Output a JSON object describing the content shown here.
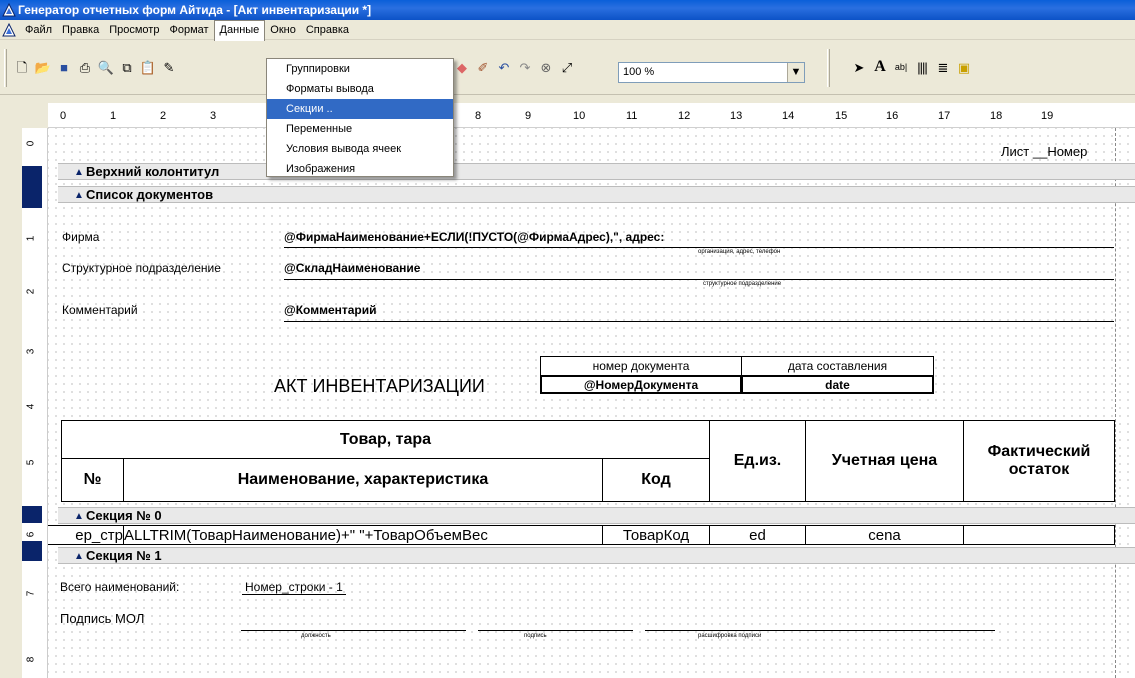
{
  "window": {
    "title": "Генератор отчетных форм Айтида - [Акт инвентаризации *]"
  },
  "menubar": {
    "items": [
      "Файл",
      "Правка",
      "Просмотр",
      "Формат",
      "Данные",
      "Окно",
      "Справка"
    ],
    "active": "Данные"
  },
  "toolbar": {
    "zoom": "100 %"
  },
  "data_menu": {
    "items": [
      "Группировки",
      "Форматы вывода",
      "Секции ..",
      "Переменные",
      "Условия вывода ячеек",
      "Изображения"
    ],
    "selected": "Секции .."
  },
  "ruler": {
    "marks": [
      "0",
      "1",
      "2",
      "3",
      "8",
      "9",
      "10",
      "11",
      "12",
      "13",
      "14",
      "15",
      "16",
      "17",
      "18",
      "19"
    ],
    "vmarks": [
      "0",
      "1",
      "2",
      "3",
      "4",
      "5",
      "6",
      "7",
      "8"
    ]
  },
  "report": {
    "sheet_label": "Лист __Номер",
    "bands": {
      "header": "Верхний колонтитул",
      "doc_list": "Список документов",
      "section0": "Секция № 0",
      "section1": "Секция № 1"
    },
    "fields": {
      "firm_label": "Фирма",
      "firm_value": "@ФирмаНаименование+ЕСЛИ(!ПУСТО(@ФирмаАдрес),\", адрес:",
      "firm_caption": "организация, адрес, телефон",
      "dept_label": "Структурное подразделение",
      "dept_value": "@СкладНаименование",
      "dept_caption": "структурное подразделение",
      "comment_label": "Комментарий",
      "comment_value": "@Комментарий"
    },
    "doc_header": {
      "title": "АКТ ИНВЕНТАРИЗАЦИИ",
      "num_label": "номер документа",
      "date_label": "дата составления",
      "num_value": "@НомерДокумента",
      "date_value": "date"
    },
    "table_header": {
      "goods": "Товар, тара",
      "num": "№",
      "name": "Наименование, характеристика",
      "code": "Код",
      "unit": "Ед.из.",
      "price": "Учетная цена",
      "fact": "Фактический остаток"
    },
    "table_row": {
      "num": "ер_стр",
      "name": "ALLTRIM(ТоварНаименование)+\" \"+ТоварОбъемВес",
      "code": "ТоварКод",
      "unit": "ed",
      "price": "cena",
      "fact": ""
    },
    "footer": {
      "total_label": "Всего наименований:",
      "total_value": "Номер_строки - 1",
      "sign_label": "Подпись МОЛ",
      "cap_position": "должность",
      "cap_sign": "подпись",
      "cap_decode": "расшифровка подписи"
    }
  }
}
